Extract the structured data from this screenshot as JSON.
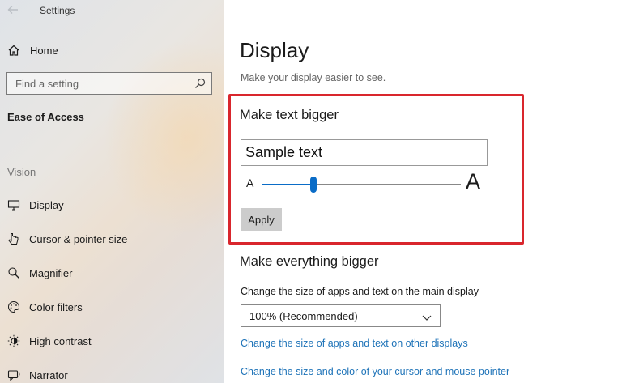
{
  "window": {
    "title": "Settings"
  },
  "sidebar": {
    "home_label": "Home",
    "search_placeholder": "Find a setting",
    "section_title": "Ease of Access",
    "group_label": "Vision",
    "items": [
      {
        "label": "Display",
        "icon": "monitor-icon"
      },
      {
        "label": "Cursor & pointer size",
        "icon": "pointer-icon"
      },
      {
        "label": "Magnifier",
        "icon": "magnifier-icon"
      },
      {
        "label": "Color filters",
        "icon": "palette-icon"
      },
      {
        "label": "High contrast",
        "icon": "contrast-icon"
      },
      {
        "label": "Narrator",
        "icon": "narrator-icon"
      }
    ]
  },
  "main": {
    "title": "Display",
    "subtitle": "Make your display easier to see.",
    "text_bigger": {
      "heading": "Make text bigger",
      "sample_text": "Sample text",
      "slider_min_label": "A",
      "slider_max_label": "A",
      "slider_value": 0.25,
      "apply_label": "Apply"
    },
    "everything_bigger": {
      "heading": "Make everything bigger",
      "field_label": "Change the size of apps and text on the main display",
      "dropdown_value": "100% (Recommended)",
      "links": [
        "Change the size of apps and text on other displays",
        "Change the size and color of your cursor and mouse pointer"
      ]
    }
  },
  "colors": {
    "accent": "#0a6cc7",
    "highlight_border": "#d9262d",
    "link": "#1e73b8"
  }
}
